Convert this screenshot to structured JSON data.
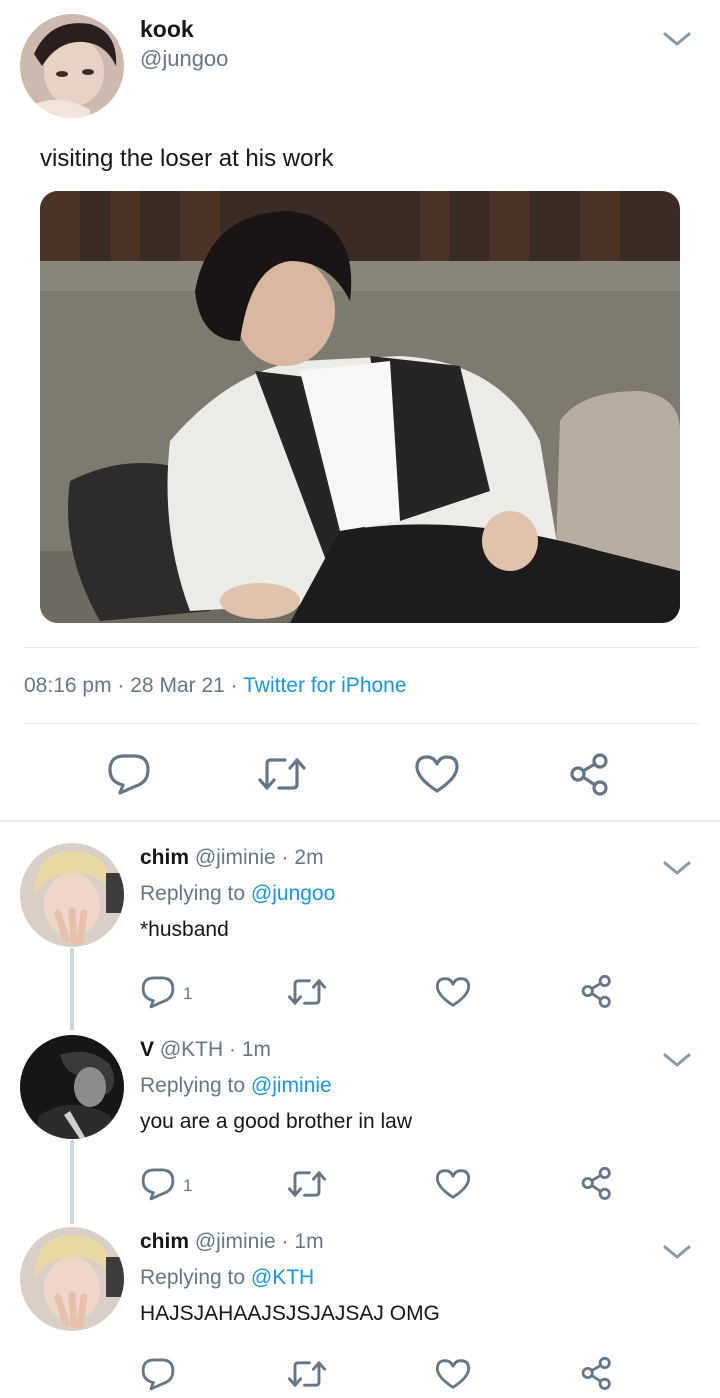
{
  "main_tweet": {
    "display_name": "kook",
    "handle": "@jungoo",
    "text": "visiting the loser at his work",
    "time": "08:16 pm",
    "sep1": "·",
    "date": "28 Mar 21",
    "sep2": "·",
    "source": "Twitter for iPhone",
    "icons": [
      "chevron-down-icon",
      "reply-icon",
      "retweet-icon",
      "like-icon",
      "share-icon"
    ]
  },
  "replies": [
    {
      "display_name": "chim",
      "handle": "@jiminie",
      "dot": "·",
      "time": "2m",
      "replying_label": "Replying to",
      "replying_handle": "@jungoo",
      "text": "*husband",
      "reply_count": "1"
    },
    {
      "display_name": "V",
      "handle": "@KTH",
      "dot": "·",
      "time": "1m",
      "replying_label": "Replying to",
      "replying_handle": "@jiminie",
      "text": "you are a good brother in law",
      "reply_count": "1"
    },
    {
      "display_name": "chim",
      "handle": "@jiminie",
      "dot": "·",
      "time": "1m",
      "replying_label": "Replying to",
      "replying_handle": "@KTH",
      "text": "HAJSJAHAAJSJSJAJSAJ OMG",
      "reply_count": ""
    }
  ],
  "colors": {
    "link": "#1b95e0",
    "muted": "#657786",
    "icon": "#657786",
    "divider": "#e1e8ed"
  }
}
